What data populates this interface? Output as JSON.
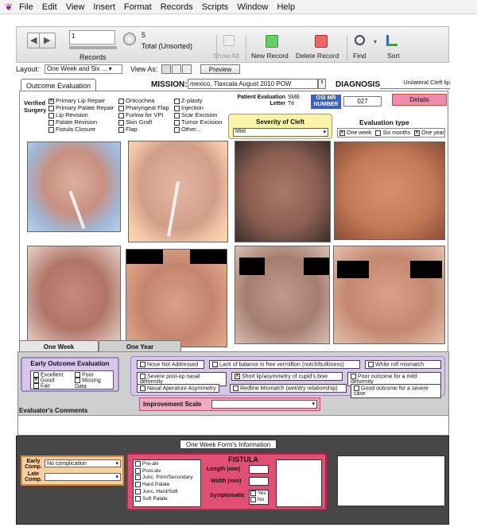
{
  "menu": [
    "File",
    "Edit",
    "View",
    "Insert",
    "Format",
    "Records",
    "Scripts",
    "Window",
    "Help"
  ],
  "toolbar": {
    "record_number": "1",
    "records_label": "Records",
    "total_count": "5",
    "total_label": "Total (Unsorted)",
    "show_all": "Show All",
    "new_record": "New Record",
    "delete_record": "Delete Record",
    "find": "Find",
    "sort": "Sort"
  },
  "layout_bar": {
    "layout_label": "Layout:",
    "layout_value": "One Week and Six ...",
    "view_as_label": "View As:",
    "preview": "Preview"
  },
  "tab_outcome": "Outcome Evaluation",
  "mission": {
    "label": "MISSION:",
    "value": "mexico, Tlaxcala August 2010 POW"
  },
  "diagnosis": {
    "label": "DIAGNOSIS",
    "value": "Unilateral Cleft lip"
  },
  "verified_label": "Verified Surgery",
  "surgery": {
    "col1": [
      {
        "label": "Primary Lip Repair",
        "checked": true
      },
      {
        "label": "Primary Palate Repair",
        "checked": false
      },
      {
        "label": "Lip Revision",
        "checked": false
      },
      {
        "label": "Palate Revision",
        "checked": false
      },
      {
        "label": "Fistula Closure",
        "checked": false
      }
    ],
    "col2": [
      {
        "label": "Orticochea",
        "checked": false
      },
      {
        "label": "Pharyngeal Flap",
        "checked": false
      },
      {
        "label": "Furlow for VPI",
        "checked": false
      },
      {
        "label": "Skin Graft",
        "checked": false
      },
      {
        "label": "Flap",
        "checked": false
      }
    ],
    "col3": [
      {
        "label": "Z-plasty",
        "checked": false
      },
      {
        "label": "Injection",
        "checked": false
      },
      {
        "label": "Scar Excision",
        "checked": false
      },
      {
        "label": "Tumor Excision",
        "checked": false
      },
      {
        "label": "Other...",
        "checked": false
      }
    ]
  },
  "patient_eval": {
    "label": "Patient Evaluation Letter",
    "sme": "SME",
    "te": "Té"
  },
  "osi": {
    "label": "OSI MR NUMBER",
    "value": "027"
  },
  "details": "Details",
  "severity": {
    "label": "Severity of Cleft",
    "value": "Mild"
  },
  "evaluation_type": {
    "label": "Evaluation type",
    "options": [
      {
        "label": "One week",
        "checked": true
      },
      {
        "label": "Six months",
        "checked": false
      },
      {
        "label": "One year",
        "checked": true
      }
    ]
  },
  "bottom_tabs": [
    "One Week",
    "One Year"
  ],
  "early_outcome": {
    "title": "Early Outcome Evaluation",
    "options": [
      {
        "label": "Excellent",
        "checked": false
      },
      {
        "label": "Poor",
        "checked": false
      },
      {
        "label": "Good",
        "checked": true
      },
      {
        "label": "Missing Data",
        "checked": false
      },
      {
        "label": "Fair",
        "checked": false
      }
    ]
  },
  "observations": [
    {
      "label": "Nose Not Addressed",
      "checked": false
    },
    {
      "label": "Lack of balance in free vermillion (notch/bulkiness)",
      "checked": false
    },
    {
      "label": "White roll mismatch",
      "checked": false
    },
    {
      "label": "Severe post-op nasal deformity",
      "checked": false
    },
    {
      "label": "Short lip/asymmetry of cupid's bow",
      "checked": true
    },
    {
      "label": "Poor outcome for a mild deformity",
      "checked": false
    },
    {
      "label": "Nasal Aperature Asymmetry",
      "checked": false
    },
    {
      "label": "Redline Mismatch (wet/dry relationship)",
      "checked": false
    },
    {
      "label": "Good outcome for a severe case",
      "checked": false
    }
  ],
  "improvement_scale": {
    "label": "Improvement Scale",
    "value": ""
  },
  "evaluator_comments": "Evaluator's Comments",
  "one_week_info": "One Week Form's Information",
  "complications": {
    "early_label": "Early Comp.",
    "early_value": "No complication",
    "late_label": "Late Comp.",
    "late_value": ""
  },
  "fistula": {
    "title": "FISTULA",
    "locations": [
      "Pre-alv",
      "Post-alv",
      "Junc. Prim/Secondary",
      "Hard Palate",
      "Junc. Hard/Soft",
      "Soft Palate"
    ],
    "length_label": "Length (mm)",
    "width_label": "Width (mm)",
    "symptomatic_label": "Symptomatic",
    "yes": "Yes",
    "no": "No"
  },
  "colors": {
    "accent_pink": "#f08ca9",
    "lavender": "#d8c6ef",
    "severity_yellow": "#fbf3a8",
    "osi_blue": "#3b5fd0",
    "fistula_red": "#e24f74"
  }
}
